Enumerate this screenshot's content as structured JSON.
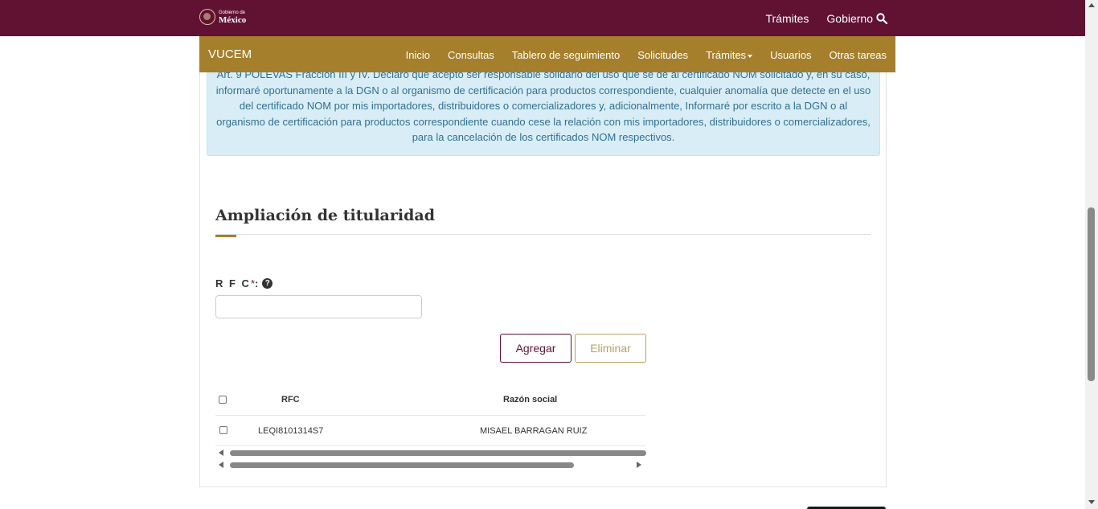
{
  "top_bar": {
    "logo_small": "Gobierno de",
    "logo_big": "México",
    "links": [
      "Trámites",
      "Gobierno"
    ]
  },
  "nav": {
    "brand": "VUCEM",
    "menu": [
      "Inicio",
      "Consultas",
      "Tablero de seguimiento",
      "Solicitudes",
      "Trámites",
      "Usuarios",
      "Otras tareas"
    ]
  },
  "alert": {
    "text": "Art. 9 POLEVAS Fracción III y IV. Declaro que acepto ser responsable solidario del uso que se dé al certificado NOM solicitado y, en su caso, informaré  oportunamente a la DGN o al organismo de certificación para productos correspondiente, cualquier anomalía que detecte en el uso del certificado NOM por mis  importadores, distribuidores o comercializadores y, adicionalmente, Informaré por escrito a la DGN o al organismo de certificación para productos correspondiente cuando cese la relación con mis  importadores, distribuidores o comercializadores, para la cancelación de los certificados NOM respectivos."
  },
  "section": {
    "title": "Ampliación de titularidad",
    "rfc_label": "R F C",
    "required_mark": "*",
    "colon": ":",
    "help_glyph": "?",
    "rfc_value": ""
  },
  "buttons": {
    "add": "Agregar",
    "delete": "Eliminar"
  },
  "table": {
    "headers": {
      "rfc": "RFC",
      "razon_social": "Razón social"
    },
    "rows": [
      {
        "rfc": "LEQI8101314S7",
        "razon_social": "MISAEL BARRAGAN RUIZ"
      }
    ]
  },
  "colors": {
    "top_bar": "#611232",
    "nav": "#a57f2c",
    "alert_bg": "#d9edf7",
    "alert_text": "#31708f"
  },
  "icons": [
    "search-icon",
    "help-icon",
    "caret-down-icon",
    "government-seal-icon"
  ]
}
